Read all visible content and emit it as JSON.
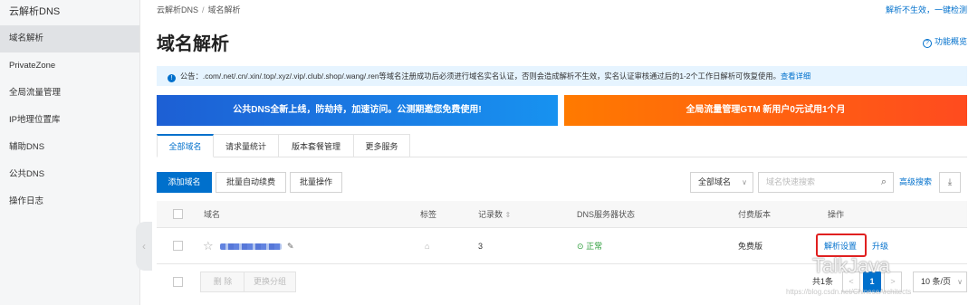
{
  "sidebar": {
    "title": "云解析DNS",
    "items": [
      {
        "label": "域名解析",
        "active": true
      },
      {
        "label": "PrivateZone"
      },
      {
        "label": "全局流量管理"
      },
      {
        "label": "IP地理位置库"
      },
      {
        "label": "辅助DNS"
      },
      {
        "label": "公共DNS"
      },
      {
        "label": "操作日志"
      }
    ],
    "collapse_icon": "chevron-left-icon"
  },
  "breadcrumb": [
    "云解析DNS",
    "域名解析"
  ],
  "header": {
    "top_link": "解析不生效，一键检测",
    "title": "域名解析",
    "overview_link": "功能概览"
  },
  "notice": {
    "text": "公告：.com/.net/.cn/.xin/.top/.xyz/.vip/.club/.shop/.wang/.ren等域名注册成功后必须进行域名实名认证，否则会造成解析不生效，实名认证审核通过后的1-2个工作日解析可恢复使用。",
    "link": "查看详细"
  },
  "banners": {
    "left": "公共DNS全新上线，防劫持，加速访问。公测期邀您免费使用!",
    "right": "全局流量管理GTM 新用户0元试用1个月"
  },
  "tabs": [
    "全部域名",
    "请求量统计",
    "版本套餐管理",
    "更多服务"
  ],
  "toolbar": {
    "add": "添加域名",
    "renew": "批量自动续费",
    "batch": "批量操作",
    "filter": "全部域名",
    "search_placeholder": "域名快速搜索",
    "advanced": "高级搜索"
  },
  "table": {
    "columns": [
      "域名",
      "标签",
      "记录数",
      "DNS服务器状态",
      "付费版本",
      "操作"
    ],
    "rows": [
      {
        "records": "3",
        "dns_status": "正常",
        "version": "免费版",
        "action_settings": "解析设置",
        "action_upgrade": "升级"
      }
    ]
  },
  "footer": {
    "delete": "删 除",
    "change_group": "更换分组",
    "total": "共1条",
    "page": "1",
    "page_size": "10 条/页"
  },
  "watermark": {
    "text": "TalkJava",
    "url": "https://blog.csdn.net/ChineseArchitects"
  },
  "colors": {
    "primary": "#0070cc",
    "banner_left": "#1d5fd4",
    "banner_right": "#ff5a14",
    "status_ok": "#2b9c3a",
    "highlight": "#e02020"
  }
}
